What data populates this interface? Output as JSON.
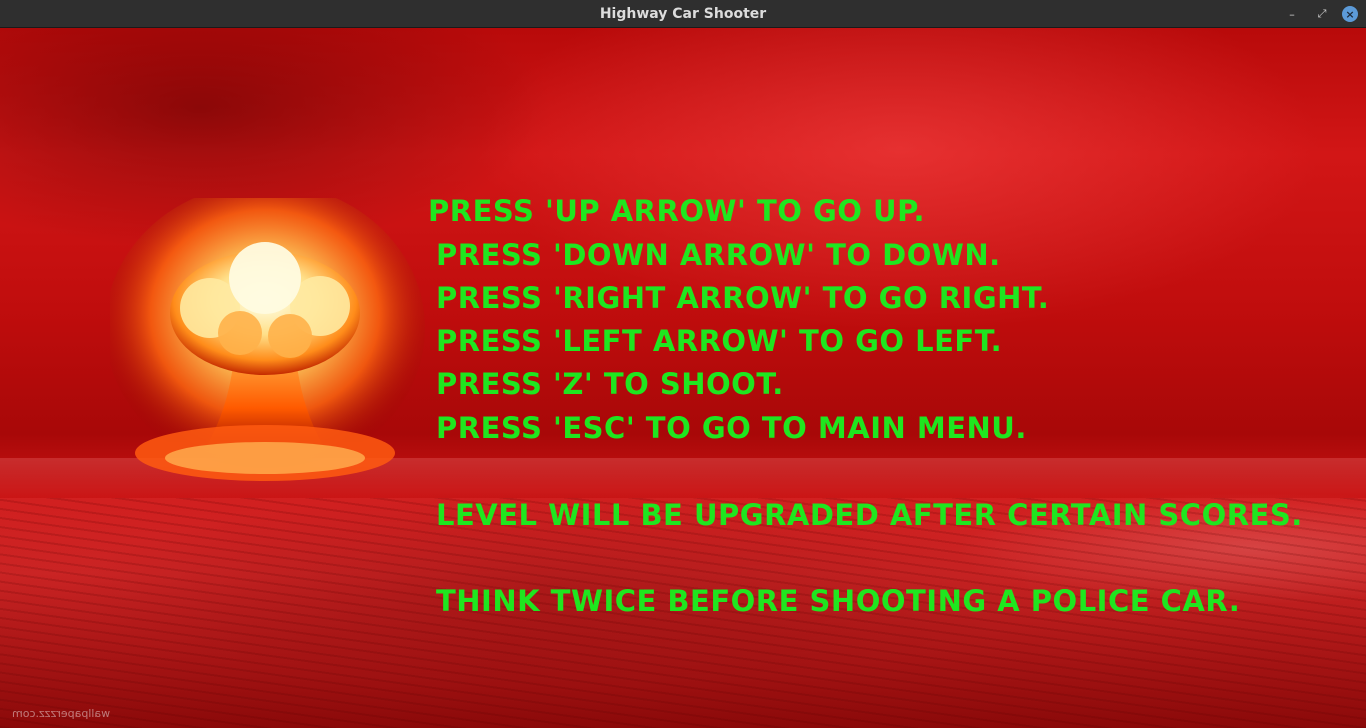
{
  "window": {
    "title": "Highway Car Shooter",
    "controls": {
      "minimize": "–",
      "maximize": "⤢",
      "close": "×"
    }
  },
  "instructions": {
    "lines": [
      "Press 'Up Arrow' to go up.",
      "Press 'Down Arrow' to down.",
      "Press 'Right Arrow' to go right.",
      "Press 'Left Arrow' to go left.",
      "Press 'Z' to shoot.",
      "Press 'ESC' to go to main menu."
    ],
    "level_note": "Level will be upgraded after certain scores.",
    "police_note": "Think twice before shooting a police car."
  },
  "background": {
    "watermark": "wallpaperzzz.com"
  },
  "colors": {
    "text": "#1fe61f",
    "background": "#c81414",
    "titlebar": "#2f2f2f"
  }
}
